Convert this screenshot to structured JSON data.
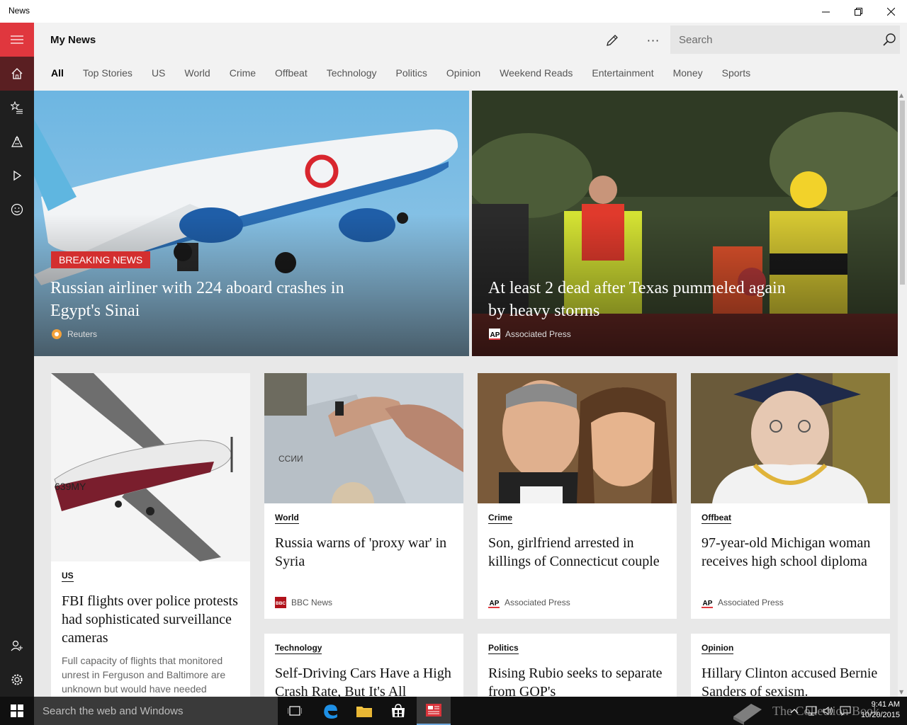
{
  "window": {
    "title": "News"
  },
  "header": {
    "page_title": "My News",
    "more_label": "···",
    "search_placeholder": "Search"
  },
  "tabs": [
    "All",
    "Top Stories",
    "US",
    "World",
    "Crime",
    "Offbeat",
    "Technology",
    "Politics",
    "Opinion",
    "Weekend Reads",
    "Entertainment",
    "Money",
    "Sports"
  ],
  "active_tab": "All",
  "heroes": [
    {
      "badge": "BREAKING NEWS",
      "headline": "Russian airliner with 224 aboard crashes in Egypt's Sinai",
      "source": "Reuters"
    },
    {
      "headline": "At least 2 dead after Texas pummeled again by heavy storms",
      "source": "Associated Press"
    }
  ],
  "cards": [
    {
      "category": "US",
      "title": "FBI flights over police protests had sophisticated surveillance cameras",
      "snippet": "Full capacity of flights that monitored unrest in Ferguson and Baltimore are unknown but would have needed"
    },
    {
      "category": "World",
      "title": "Russia warns of 'proxy war' in Syria",
      "source": "BBC News"
    },
    {
      "category": "Crime",
      "title": "Son, girlfriend arrested in killings of Connecticut couple",
      "source": "Associated Press"
    },
    {
      "category": "Offbeat",
      "title": "97-year-old Michigan woman receives high school diploma",
      "source": "Associated Press"
    },
    {
      "category": "Technology",
      "title": "Self-Driving Cars Have a High Crash Rate, But It's All"
    },
    {
      "category": "Politics",
      "title": "Rising Rubio seeks to separate from GOP's"
    },
    {
      "category": "Opinion",
      "title": "Hillary Clinton accused Bernie Sanders of sexism."
    }
  ],
  "taskbar": {
    "search_placeholder": "Search the web and Windows",
    "time": "9:41 AM",
    "date": "10/20/2015"
  },
  "watermark": "The Collection Book",
  "colors": {
    "accent": "#e0373e",
    "badge": "#d32f2f",
    "rail": "#1f1f1f"
  }
}
